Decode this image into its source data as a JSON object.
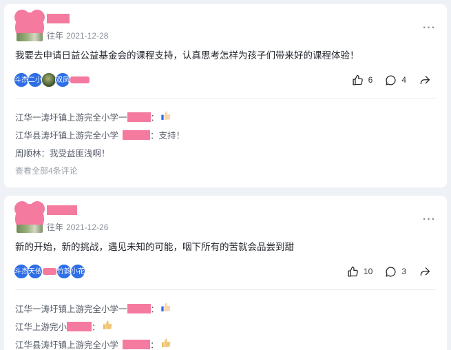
{
  "posts": [
    {
      "time_tag": "往年",
      "date": "2021-12-28",
      "content": "我要去申请日益公益基金会的课程支持，认真思考怎样为孩子们带来好的课程体验！",
      "likers": [
        "斗杰",
        "二小",
        "",
        "双凤",
        ""
      ],
      "stats": {
        "likes": "6",
        "comments": "4"
      },
      "comments": [
        {
          "name": "江华一涛圩镇上游完全小学一",
          "suffix": "："
        },
        {
          "name": "江华县涛圩镇上游完全小学",
          "suffix": "：支持！"
        },
        {
          "name": "周顺林",
          "suffix": "：我受益匪浅啊！"
        }
      ],
      "view_all": "查看全部4条评论"
    },
    {
      "time_tag": "往年",
      "date": "2021-12-26",
      "content": "新的开始，新的挑战，遇见未知的可能，咽下所有的苦就会品尝到甜",
      "likers": [
        "斗杰",
        "天依",
        "",
        "竹韵",
        "小花"
      ],
      "stats": {
        "likes": "10",
        "comments": "3"
      },
      "comments": [
        {
          "name": "江华一涛圩镇上游完全小学一",
          "suffix": "："
        },
        {
          "name": "江华上游完小",
          "suffix": "："
        },
        {
          "name": "江华县涛圩镇上游完全小学",
          "suffix": "："
        }
      ]
    }
  ],
  "icons": {
    "like": "thumbs-up-icon",
    "comment": "comment-bubble-icon",
    "share": "share-arrow-icon",
    "more": "more-dots-icon"
  },
  "colors": {
    "accent": "#2e6ee6",
    "mask": "#f47aa0",
    "card": "#ffffff",
    "page": "#eef1f5"
  }
}
